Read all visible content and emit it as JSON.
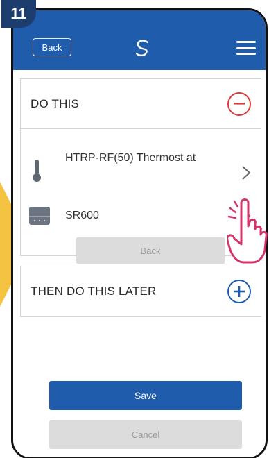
{
  "step": {
    "number": "11"
  },
  "header": {
    "back_label": "Back",
    "logo_icon": "salus-logo-icon",
    "menu_icon": "hamburger-menu-icon",
    "background_color": "#1f5cab"
  },
  "do_this": {
    "title": "DO THIS",
    "action_icon": "minus-circle-icon",
    "devices": [
      {
        "label": "HTRP-RF(50) Thermost at",
        "icon": "thermometer-icon"
      },
      {
        "label": "SR600",
        "icon": "smart-relay-icon"
      }
    ],
    "back_label": "Back"
  },
  "then_later": {
    "title": "THEN DO THIS LATER",
    "action_icon": "plus-circle-icon"
  },
  "buttons": {
    "save_label": "Save",
    "cancel_label": "Cancel"
  },
  "colors": {
    "accent": "#1f5cab",
    "danger": "#e03a3a",
    "badge": "#1d3d6e",
    "highlight_arrow": "#f5c342",
    "pointer": "#d6336c"
  }
}
